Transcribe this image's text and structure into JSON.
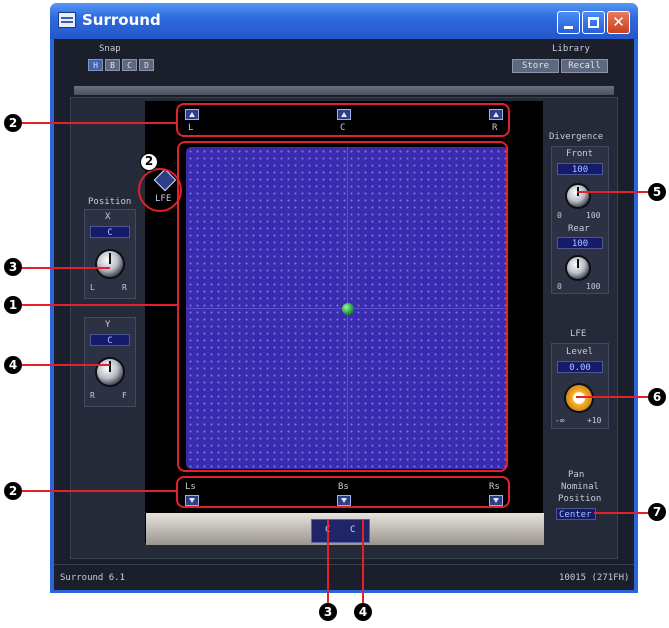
{
  "window": {
    "title": "Surround",
    "icon": "app-icon"
  },
  "snap": {
    "label": "Snap",
    "buttons": [
      "H",
      "B",
      "C",
      "D"
    ]
  },
  "library": {
    "label": "Library",
    "store": "Store",
    "recall": "Recall"
  },
  "speakers": {
    "front": [
      "L",
      "C",
      "R"
    ],
    "rear": [
      "Ls",
      "Bs",
      "Rs"
    ],
    "lfe": "LFE"
  },
  "position": {
    "label": "Position",
    "x": {
      "label": "X",
      "value": "C",
      "min": "L",
      "max": "R"
    },
    "y": {
      "label": "Y",
      "value": "C",
      "min": "R",
      "max": "F"
    }
  },
  "divergence": {
    "label": "Divergence",
    "front": {
      "label": "Front",
      "value": "100",
      "min": "0",
      "max": "100"
    },
    "rear": {
      "label": "Rear",
      "value": "100",
      "min": "0",
      "max": "100"
    }
  },
  "lfe": {
    "label": "LFE",
    "level_label": "Level",
    "value": "0.00",
    "min": "-∞",
    "max": "+10"
  },
  "pan_nominal": {
    "line1": "Pan",
    "line2": "Nominal",
    "line3": "Position",
    "value": "Center"
  },
  "bottom_values": [
    "C",
    "C"
  ],
  "status": {
    "left": "Surround   6.1",
    "right": "10015 (271FH)"
  },
  "callouts": [
    "1",
    "2",
    "3",
    "4",
    "5",
    "6",
    "7"
  ],
  "colors": {
    "callout_line": "#e3212a",
    "grid": "#3a2bb0",
    "value_text": "#a9c6ff"
  }
}
